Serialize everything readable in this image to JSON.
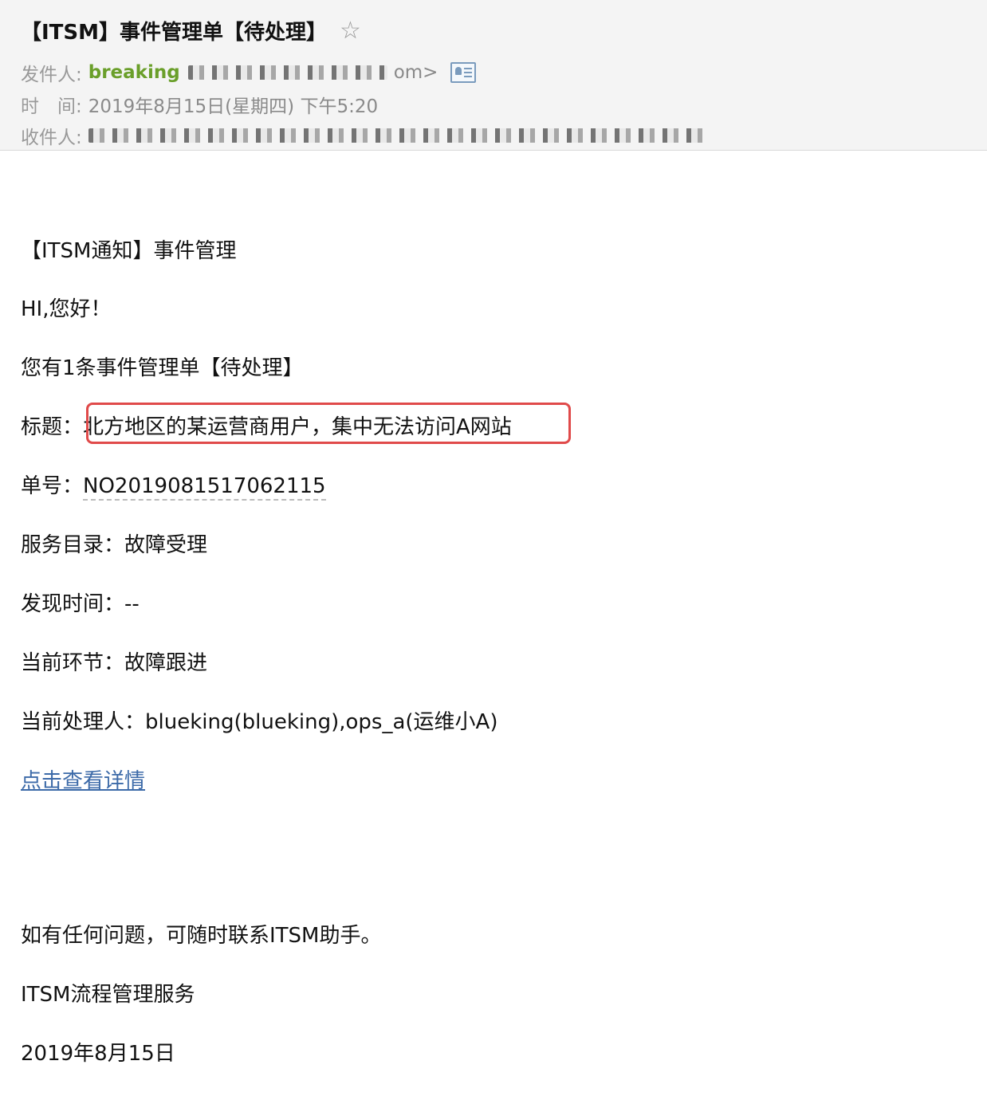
{
  "header": {
    "subject": "【ITSM】事件管理单【待处理】",
    "from_label": "发件人:",
    "from_name": "breaking",
    "from_email_tail": "om>",
    "time_label": "时　间:",
    "time_value": "2019年8月15日(星期四) 下午5:20",
    "to_label": "收件人:"
  },
  "body": {
    "notice_title": "【ITSM通知】事件管理",
    "greeting": "HI,您好！",
    "pending_text": "您有1条事件管理单【待处理】",
    "title_label": "标题：",
    "title_value": "北方地区的某运营商用户，集中无法访问A网站",
    "number_label": "单号：",
    "number_value": "NO2019081517062115",
    "catalog_label": "服务目录：",
    "catalog_value": "故障受理",
    "found_time_label": "发现时间：",
    "found_time_value": "--",
    "current_stage_label": "当前环节：",
    "current_stage_value": "故障跟进",
    "handler_label": "当前处理人：",
    "handler_value": "blueking(blueking),ops_a(运维小A)",
    "detail_link": "点击查看详情",
    "contact_text": "如有任何问题，可随时联系ITSM助手。",
    "service_name": "ITSM流程管理服务",
    "date": "2019年8月15日"
  },
  "colors": {
    "sender_name": "#6a9f2a",
    "link": "#3c6aa8",
    "highlight_border": "#e04a4a",
    "header_bg": "#f4f4f4"
  },
  "icons": {
    "star": "star-outline-icon",
    "contact_card": "contact-card-icon"
  }
}
